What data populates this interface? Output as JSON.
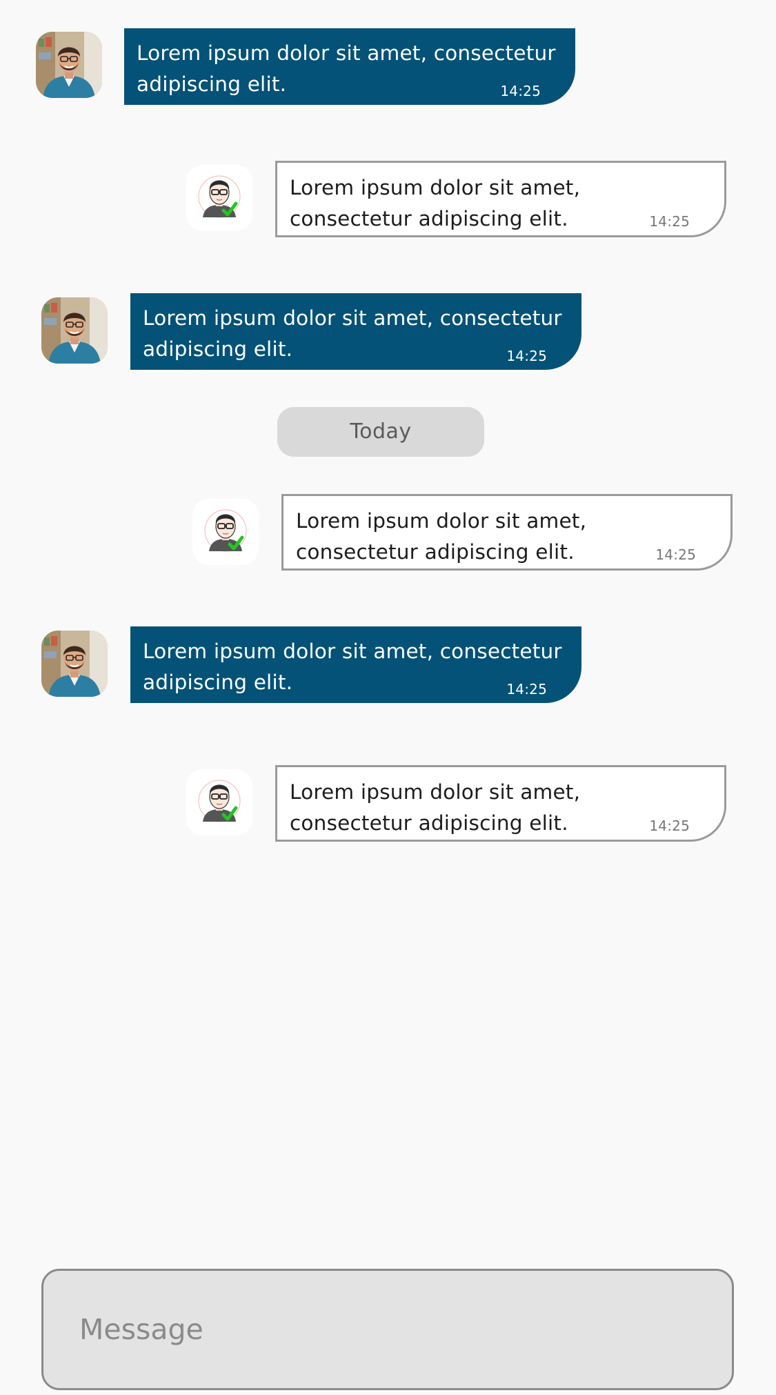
{
  "conversation": {
    "date_separator": "Today",
    "messages": [
      {
        "direction": "incoming",
        "text": "Lorem ipsum dolor sit amet, consectetur adipiscing elit.",
        "time": "14:25"
      },
      {
        "direction": "outgoing",
        "text": "Lorem ipsum dolor sit amet, consectetur adipiscing elit.",
        "time": "14:25"
      },
      {
        "direction": "incoming",
        "text": "Lorem ipsum dolor sit amet, consectetur adipiscing elit.",
        "time": "14:25"
      },
      {
        "direction": "outgoing",
        "text": "Lorem ipsum dolor sit amet, consectetur adipiscing elit.",
        "time": "14:25"
      },
      {
        "direction": "incoming",
        "text": "Lorem ipsum dolor sit amet, consectetur adipiscing elit.",
        "time": "14:25"
      },
      {
        "direction": "outgoing",
        "text": "Lorem ipsum dolor sit amet, consectetur adipiscing elit.",
        "time": "14:25"
      }
    ]
  },
  "composer": {
    "placeholder": "Message"
  },
  "icons": {
    "incoming_avatar": "user-photo-avatar",
    "outgoing_avatar": "cartoon-user-verified-avatar"
  },
  "colors": {
    "incoming_bubble": "#045277",
    "outgoing_bubble_border": "#9a9a9a",
    "background": "#f9f9f9",
    "date_pill": "#d9d9d9",
    "composer_background": "#e3e3e3",
    "verified_check": "#22c722"
  }
}
